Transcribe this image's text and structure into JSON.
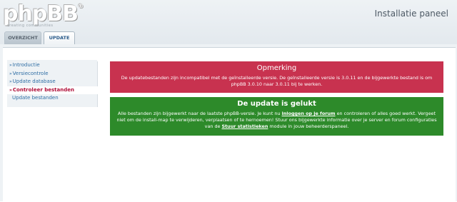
{
  "header": {
    "logo_text": "phpBB",
    "logo_mark": "®",
    "tagline": "creating communities",
    "panel_title": "Installatie paneel"
  },
  "tabs": [
    {
      "label": "OVERZICHT",
      "active": false
    },
    {
      "label": "UPDATE",
      "active": true
    }
  ],
  "menu": {
    "items": [
      {
        "label": "Introductie",
        "marker": "»"
      },
      {
        "label": "Versiecontrole",
        "marker": "»"
      },
      {
        "label": "Update database",
        "marker": "»"
      },
      {
        "label": "Controleer bestanden",
        "marker": "»",
        "active": true
      },
      {
        "label": "Update bestanden",
        "marker": ""
      }
    ]
  },
  "notice": {
    "title": "Opmerking",
    "text": "De updatebestanden zijn incompatibel met de geïnstalleerde versie. De geïnstalleerde versie is 3.0.11 en de bijgewerkte bestand is om phpBB 3.0.10 naar 3.0.11 bij te werken."
  },
  "success": {
    "title": "De update is gelukt",
    "text_1": "Alle bestanden zijn bijgewerkt naar de laatste phpBB-versie. Je kunt nu ",
    "link_login": "inloggen op je forum",
    "text_2": " en controleren of alles goed werkt. Vergeet niet om de install-map te verwijderen, verplaatsen of te hernoemen! Stuur ons bijgewerkte informatie over je server en forum configuraties van de ",
    "link_stats": "Stuur statistieken",
    "text_3": " module in jouw beheerderspaneel."
  },
  "colors": {
    "error_bg": "#c8324f",
    "success_bg": "#2d8a2a",
    "link": "#2e6da4",
    "active_menu": "#b0103a"
  }
}
